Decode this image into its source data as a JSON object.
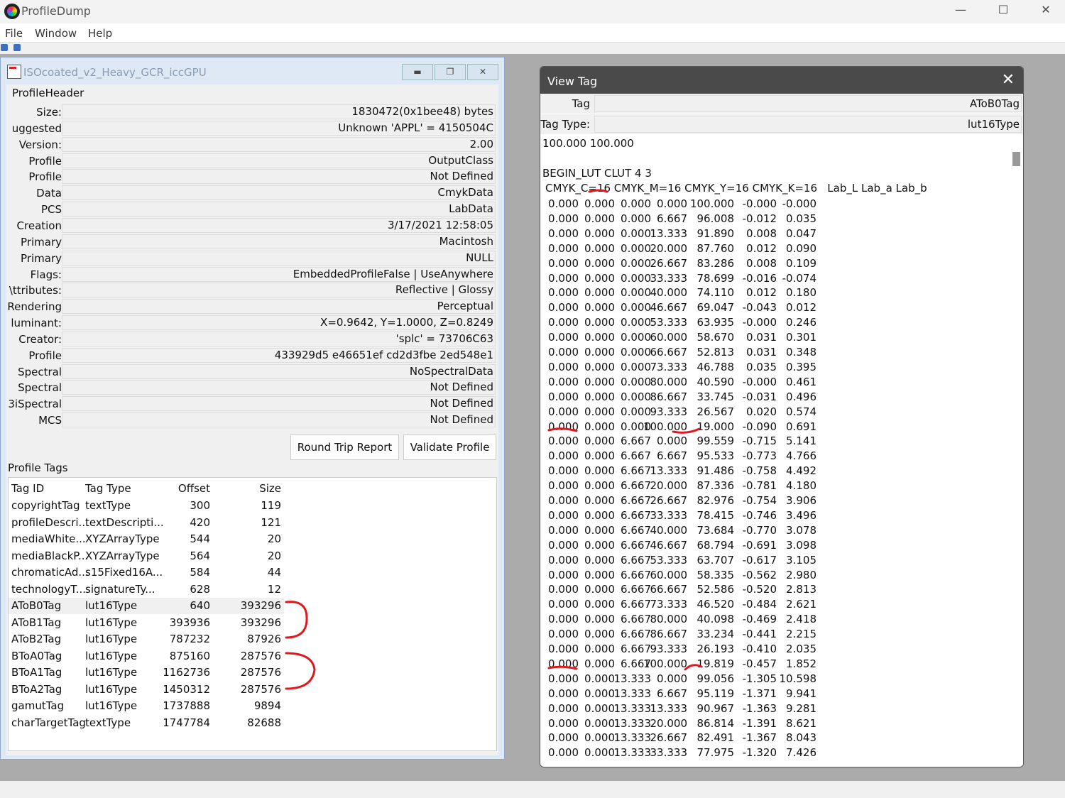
{
  "app": {
    "title": "ProfileDump",
    "menu": [
      "File",
      "Window",
      "Help"
    ]
  },
  "child": {
    "title": "ISOcoated_v2_Heavy_GCR_iccGPU",
    "header_label": "ProfileHeader",
    "header": [
      [
        "Size:",
        "1830472(0x1bee48) bytes"
      ],
      [
        "uggested",
        "Unknown 'APPL' = 4150504C"
      ],
      [
        "Version:",
        "2.00"
      ],
      [
        "Profile",
        "OutputClass"
      ],
      [
        "Profile",
        "Not Defined"
      ],
      [
        "Data",
        "CmykData"
      ],
      [
        "PCS",
        "LabData"
      ],
      [
        "Creation",
        "3/17/2021  12:58:05"
      ],
      [
        "Primary",
        "Macintosh"
      ],
      [
        "Primary",
        "NULL"
      ],
      [
        "Flags:",
        "EmbeddedProfileFalse | UseAnywhere"
      ],
      [
        "\\ttributes:",
        "Reflective | Glossy"
      ],
      [
        "Rendering",
        "Perceptual"
      ],
      [
        "luminant:",
        "X=0.9642, Y=1.0000, Z=0.8249"
      ],
      [
        "Creator:",
        "'splc' = 73706C63"
      ],
      [
        "Profile",
        "433929d5 e46651ef cd2d3fbe 2ed548e1"
      ],
      [
        "Spectral",
        "NoSpectralData"
      ],
      [
        "Spectral",
        "Not Defined"
      ],
      [
        "3iSpectral",
        "Not Defined"
      ],
      [
        "MCS",
        "Not Defined"
      ]
    ],
    "round_trip_label": "Round Trip Report",
    "validate_label": "Validate Profile",
    "tags_label": "Profile Tags",
    "tag_columns": [
      "Tag ID",
      "Tag Type",
      "Offset",
      "Size"
    ],
    "tags": [
      [
        "copyrightTag",
        "textType",
        "300",
        "119"
      ],
      [
        "profileDescri...",
        "textDescripti...",
        "420",
        "121"
      ],
      [
        "mediaWhite...",
        "XYZArrayType",
        "544",
        "20"
      ],
      [
        "mediaBlackP...",
        "XYZArrayType",
        "564",
        "20"
      ],
      [
        "chromaticAd...",
        "s15Fixed16A...",
        "584",
        "44"
      ],
      [
        "technologyT...",
        "signatureTy...",
        "628",
        "12"
      ],
      [
        "AToB0Tag",
        "lut16Type",
        "640",
        "393296"
      ],
      [
        "AToB1Tag",
        "lut16Type",
        "393936",
        "393296"
      ],
      [
        "AToB2Tag",
        "lut16Type",
        "787232",
        "87926"
      ],
      [
        "BToA0Tag",
        "lut16Type",
        "875160",
        "287576"
      ],
      [
        "BToA1Tag",
        "lut16Type",
        "1162736",
        "287576"
      ],
      [
        "BToA2Tag",
        "lut16Type",
        "1450312",
        "287576"
      ],
      [
        "gamutTag",
        "lut16Type",
        "1737888",
        "9894"
      ],
      [
        "charTargetTag",
        "textType",
        "1747784",
        "82688"
      ]
    ]
  },
  "dialog": {
    "title": "View Tag",
    "tag_label": "Tag",
    "tag_value": "AToB0Tag",
    "type_label": "Tag Type:",
    "type_value": "lut16Type",
    "line1": "100.000 100.000",
    "line2": "BEGIN_LUT CLUT 4 3",
    "line3": "CMYK_C=16 CMYK_M=16 CMYK_Y=16 CMYK_K=16   Lab_L Lab_a Lab_b",
    "rows": [
      [
        "0.000",
        "0.000",
        "0.000",
        "0.000",
        "100.000",
        "-0.000",
        "-0.000"
      ],
      [
        "0.000",
        "0.000",
        "0.000",
        "6.667",
        "96.008",
        "-0.012",
        "0.035"
      ],
      [
        "0.000",
        "0.000",
        "0.000",
        "13.333",
        "91.890",
        "0.008",
        "0.047"
      ],
      [
        "0.000",
        "0.000",
        "0.000",
        "20.000",
        "87.760",
        "0.012",
        "0.090"
      ],
      [
        "0.000",
        "0.000",
        "0.000",
        "26.667",
        "83.286",
        "0.008",
        "0.109"
      ],
      [
        "0.000",
        "0.000",
        "0.000",
        "33.333",
        "78.699",
        "-0.016",
        "-0.074"
      ],
      [
        "0.000",
        "0.000",
        "0.000",
        "40.000",
        "74.110",
        "0.012",
        "0.180"
      ],
      [
        "0.000",
        "0.000",
        "0.000",
        "46.667",
        "69.047",
        "-0.043",
        "0.012"
      ],
      [
        "0.000",
        "0.000",
        "0.000",
        "53.333",
        "63.935",
        "-0.000",
        "0.246"
      ],
      [
        "0.000",
        "0.000",
        "0.000",
        "60.000",
        "58.670",
        "0.031",
        "0.301"
      ],
      [
        "0.000",
        "0.000",
        "0.000",
        "66.667",
        "52.813",
        "0.031",
        "0.348"
      ],
      [
        "0.000",
        "0.000",
        "0.000",
        "73.333",
        "46.788",
        "0.035",
        "0.395"
      ],
      [
        "0.000",
        "0.000",
        "0.000",
        "80.000",
        "40.590",
        "-0.000",
        "0.461"
      ],
      [
        "0.000",
        "0.000",
        "0.000",
        "86.667",
        "33.745",
        "-0.031",
        "0.496"
      ],
      [
        "0.000",
        "0.000",
        "0.000",
        "93.333",
        "26.567",
        "0.020",
        "0.574"
      ],
      [
        "0.000",
        "0.000",
        "0.000",
        "100.000",
        "19.000",
        "-0.090",
        "0.691"
      ],
      [
        "0.000",
        "0.000",
        "6.667",
        "0.000",
        "99.559",
        "-0.715",
        "5.141"
      ],
      [
        "0.000",
        "0.000",
        "6.667",
        "6.667",
        "95.533",
        "-0.773",
        "4.766"
      ],
      [
        "0.000",
        "0.000",
        "6.667",
        "13.333",
        "91.486",
        "-0.758",
        "4.492"
      ],
      [
        "0.000",
        "0.000",
        "6.667",
        "20.000",
        "87.336",
        "-0.781",
        "4.180"
      ],
      [
        "0.000",
        "0.000",
        "6.667",
        "26.667",
        "82.976",
        "-0.754",
        "3.906"
      ],
      [
        "0.000",
        "0.000",
        "6.667",
        "33.333",
        "78.415",
        "-0.746",
        "3.496"
      ],
      [
        "0.000",
        "0.000",
        "6.667",
        "40.000",
        "73.684",
        "-0.770",
        "3.078"
      ],
      [
        "0.000",
        "0.000",
        "6.667",
        "46.667",
        "68.794",
        "-0.691",
        "3.098"
      ],
      [
        "0.000",
        "0.000",
        "6.667",
        "53.333",
        "63.707",
        "-0.617",
        "3.105"
      ],
      [
        "0.000",
        "0.000",
        "6.667",
        "60.000",
        "58.335",
        "-0.562",
        "2.980"
      ],
      [
        "0.000",
        "0.000",
        "6.667",
        "66.667",
        "52.586",
        "-0.520",
        "2.813"
      ],
      [
        "0.000",
        "0.000",
        "6.667",
        "73.333",
        "46.520",
        "-0.484",
        "2.621"
      ],
      [
        "0.000",
        "0.000",
        "6.667",
        "80.000",
        "40.098",
        "-0.469",
        "2.418"
      ],
      [
        "0.000",
        "0.000",
        "6.667",
        "86.667",
        "33.234",
        "-0.441",
        "2.215"
      ],
      [
        "0.000",
        "0.000",
        "6.667",
        "93.333",
        "26.193",
        "-0.410",
        "2.035"
      ],
      [
        "0.000",
        "0.000",
        "6.667",
        "100.000",
        "19.819",
        "-0.457",
        "1.852"
      ],
      [
        "0.000",
        "0.000",
        "13.333",
        "0.000",
        "99.056",
        "-1.305",
        "10.598"
      ],
      [
        "0.000",
        "0.000",
        "13.333",
        "6.667",
        "95.119",
        "-1.371",
        "9.941"
      ],
      [
        "0.000",
        "0.000",
        "13.333",
        "13.333",
        "90.967",
        "-1.363",
        "9.281"
      ],
      [
        "0.000",
        "0.000",
        "13.333",
        "20.000",
        "86.814",
        "-1.391",
        "8.621"
      ],
      [
        "0.000",
        "0.000",
        "13.333",
        "26.667",
        "82.491",
        "-1.367",
        "8.043"
      ],
      [
        "0.000",
        "0.000",
        "13.333",
        "33.333",
        "77.975",
        "-1.320",
        "7.426"
      ]
    ]
  }
}
